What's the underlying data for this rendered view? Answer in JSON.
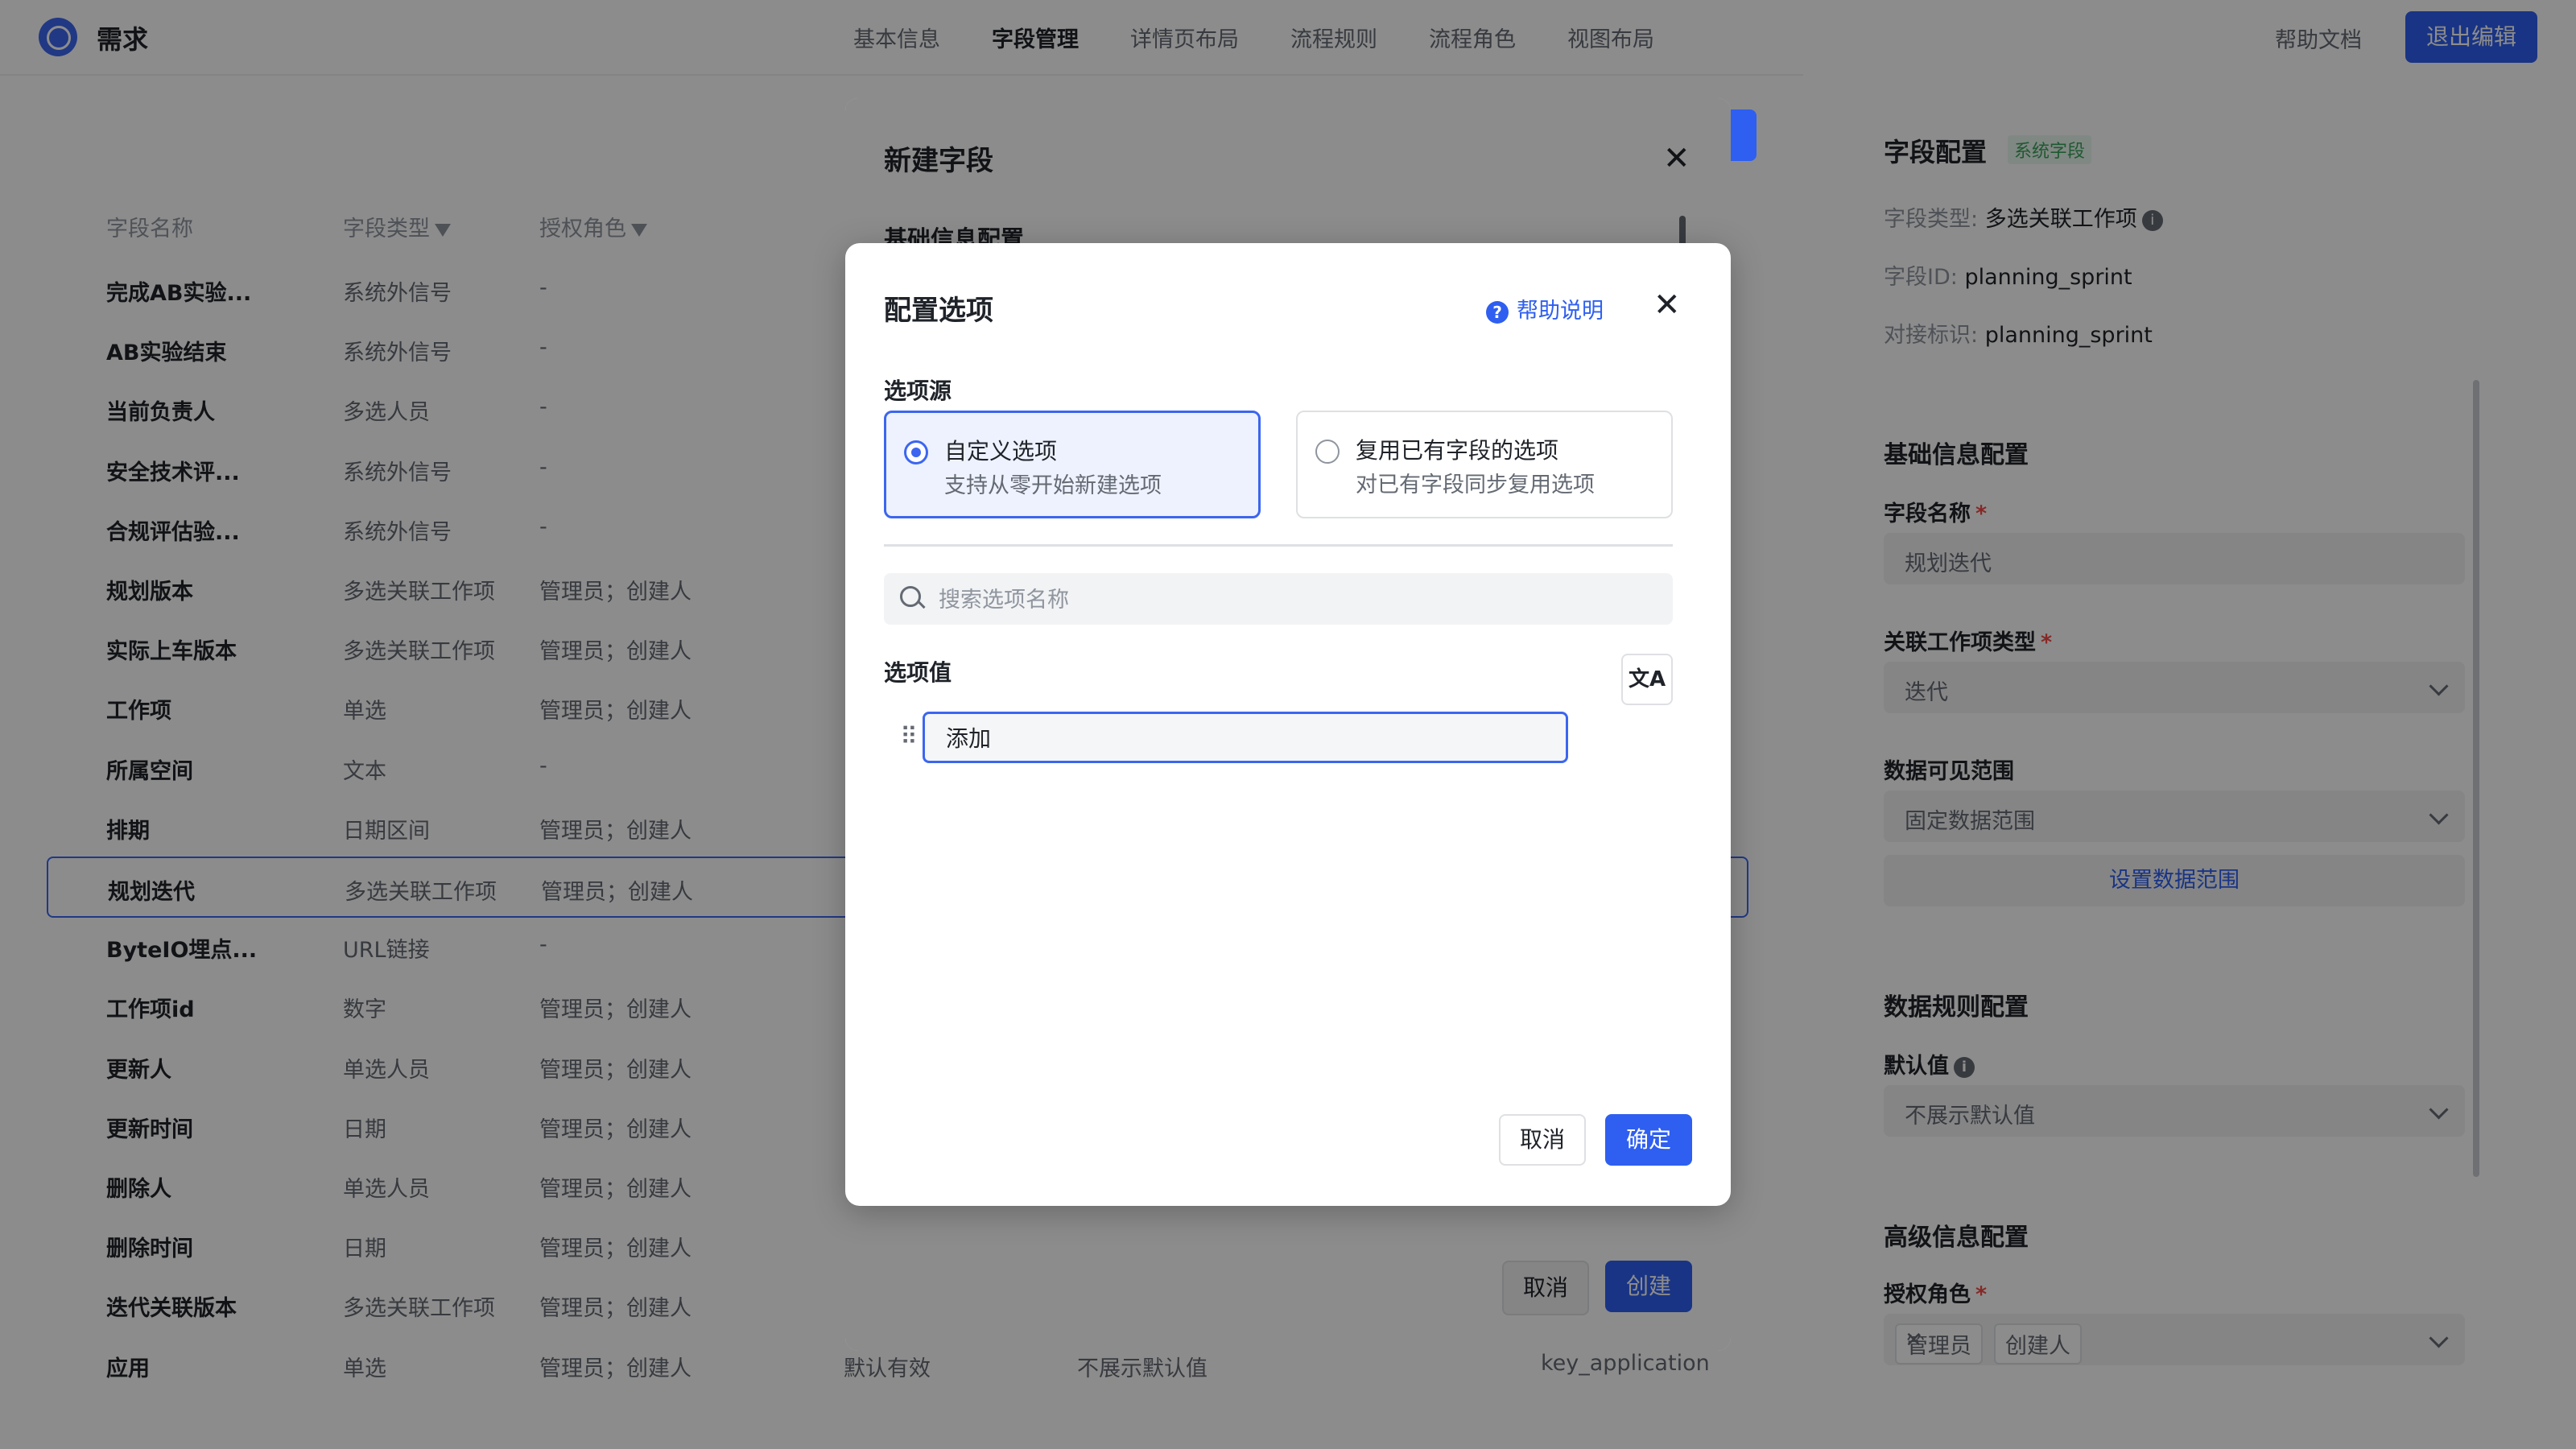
{
  "header": {
    "app_title": "需求",
    "nav": [
      "基本信息",
      "字段管理",
      "详情页布局",
      "流程规则",
      "流程角色",
      "视图布局"
    ],
    "active_nav": "字段管理",
    "help_doc": "帮助文档",
    "exit_edit": "退出编辑"
  },
  "table": {
    "headers": {
      "name": "字段名称",
      "type": "字段类型",
      "role": "授权角色"
    },
    "rows": [
      {
        "name": "完成AB实验...",
        "type": "系统外信号",
        "role": "-"
      },
      {
        "name": "AB实验结束",
        "type": "系统外信号",
        "role": "-"
      },
      {
        "name": "当前负责人",
        "type": "多选人员",
        "role": "-"
      },
      {
        "name": "安全技术评...",
        "type": "系统外信号",
        "role": "-"
      },
      {
        "name": "合规评估验...",
        "type": "系统外信号",
        "role": "-"
      },
      {
        "name": "规划版本",
        "type": "多选关联工作项",
        "role": "管理员；创建人"
      },
      {
        "name": "实际上车版本",
        "type": "多选关联工作项",
        "role": "管理员；创建人"
      },
      {
        "name": "工作项",
        "type": "单选",
        "role": "管理员；创建人"
      },
      {
        "name": "所属空间",
        "type": "文本",
        "role": "-"
      },
      {
        "name": "排期",
        "type": "日期区间",
        "role": "管理员；创建人"
      },
      {
        "name": "规划迭代",
        "type": "多选关联工作项",
        "role": "管理员；创建人"
      },
      {
        "name": "ByteIO埋点...",
        "type": "URL链接",
        "role": "-"
      },
      {
        "name": "工作项id",
        "type": "数字",
        "role": "管理员；创建人"
      },
      {
        "name": "更新人",
        "type": "单选人员",
        "role": "管理员；创建人"
      },
      {
        "name": "更新时间",
        "type": "日期",
        "role": "管理员；创建人"
      },
      {
        "name": "删除人",
        "type": "单选人员",
        "role": "管理员；创建人"
      },
      {
        "name": "删除时间",
        "type": "日期",
        "role": "管理员；创建人"
      },
      {
        "name": "迭代关联版本",
        "type": "多选关联工作项",
        "role": "管理员；创建人"
      },
      {
        "name": "应用",
        "type": "单选",
        "role": "管理员；创建人",
        "permission": "默认有效",
        "default": "不展示默认值",
        "key": "key_application"
      }
    ]
  },
  "right_panel": {
    "title": "字段配置",
    "tag": "系统字段",
    "field_type_label": "字段类型:",
    "field_type_value": "多选关联工作项",
    "field_id_label": "字段ID:",
    "field_id_value": "planning_sprint",
    "api_key_label": "对接标识:",
    "api_key_value": "planning_sprint",
    "basic_section": "基础信息配置",
    "field_name_label": "字段名称",
    "field_name_value": "规划迭代",
    "related_type_label": "关联工作项类型",
    "related_type_value": "迭代",
    "data_scope_label": "数据可见范围",
    "data_scope_value": "固定数据范围",
    "set_scope_link": "设置数据范围",
    "rules_section": "数据规则配置",
    "default_label": "默认值",
    "default_value": "不展示默认值",
    "advanced_section": "高级信息配置",
    "roles_label": "授权角色",
    "role_chips": [
      "管理员",
      "创建人"
    ]
  },
  "new_field_modal": {
    "title": "新建字段",
    "section": "基础信息配置",
    "cancel": "取消",
    "create": "创建"
  },
  "options_modal": {
    "title": "配置选项",
    "help": "帮助说明",
    "source_label": "选项源",
    "custom_title": "自定义选项",
    "custom_desc": "支持从零开始新建选项",
    "reuse_title": "复用已有字段的选项",
    "reuse_desc": "对已有字段同步复用选项",
    "search_placeholder": "搜索选项名称",
    "values_label": "选项值",
    "translate_icon": "文A",
    "option_input_value": "添加",
    "cancel": "取消",
    "ok": "确定"
  },
  "colors": {
    "primary": "#2e5ff0",
    "overlay": "rgba(0,0,0,0.45)"
  }
}
